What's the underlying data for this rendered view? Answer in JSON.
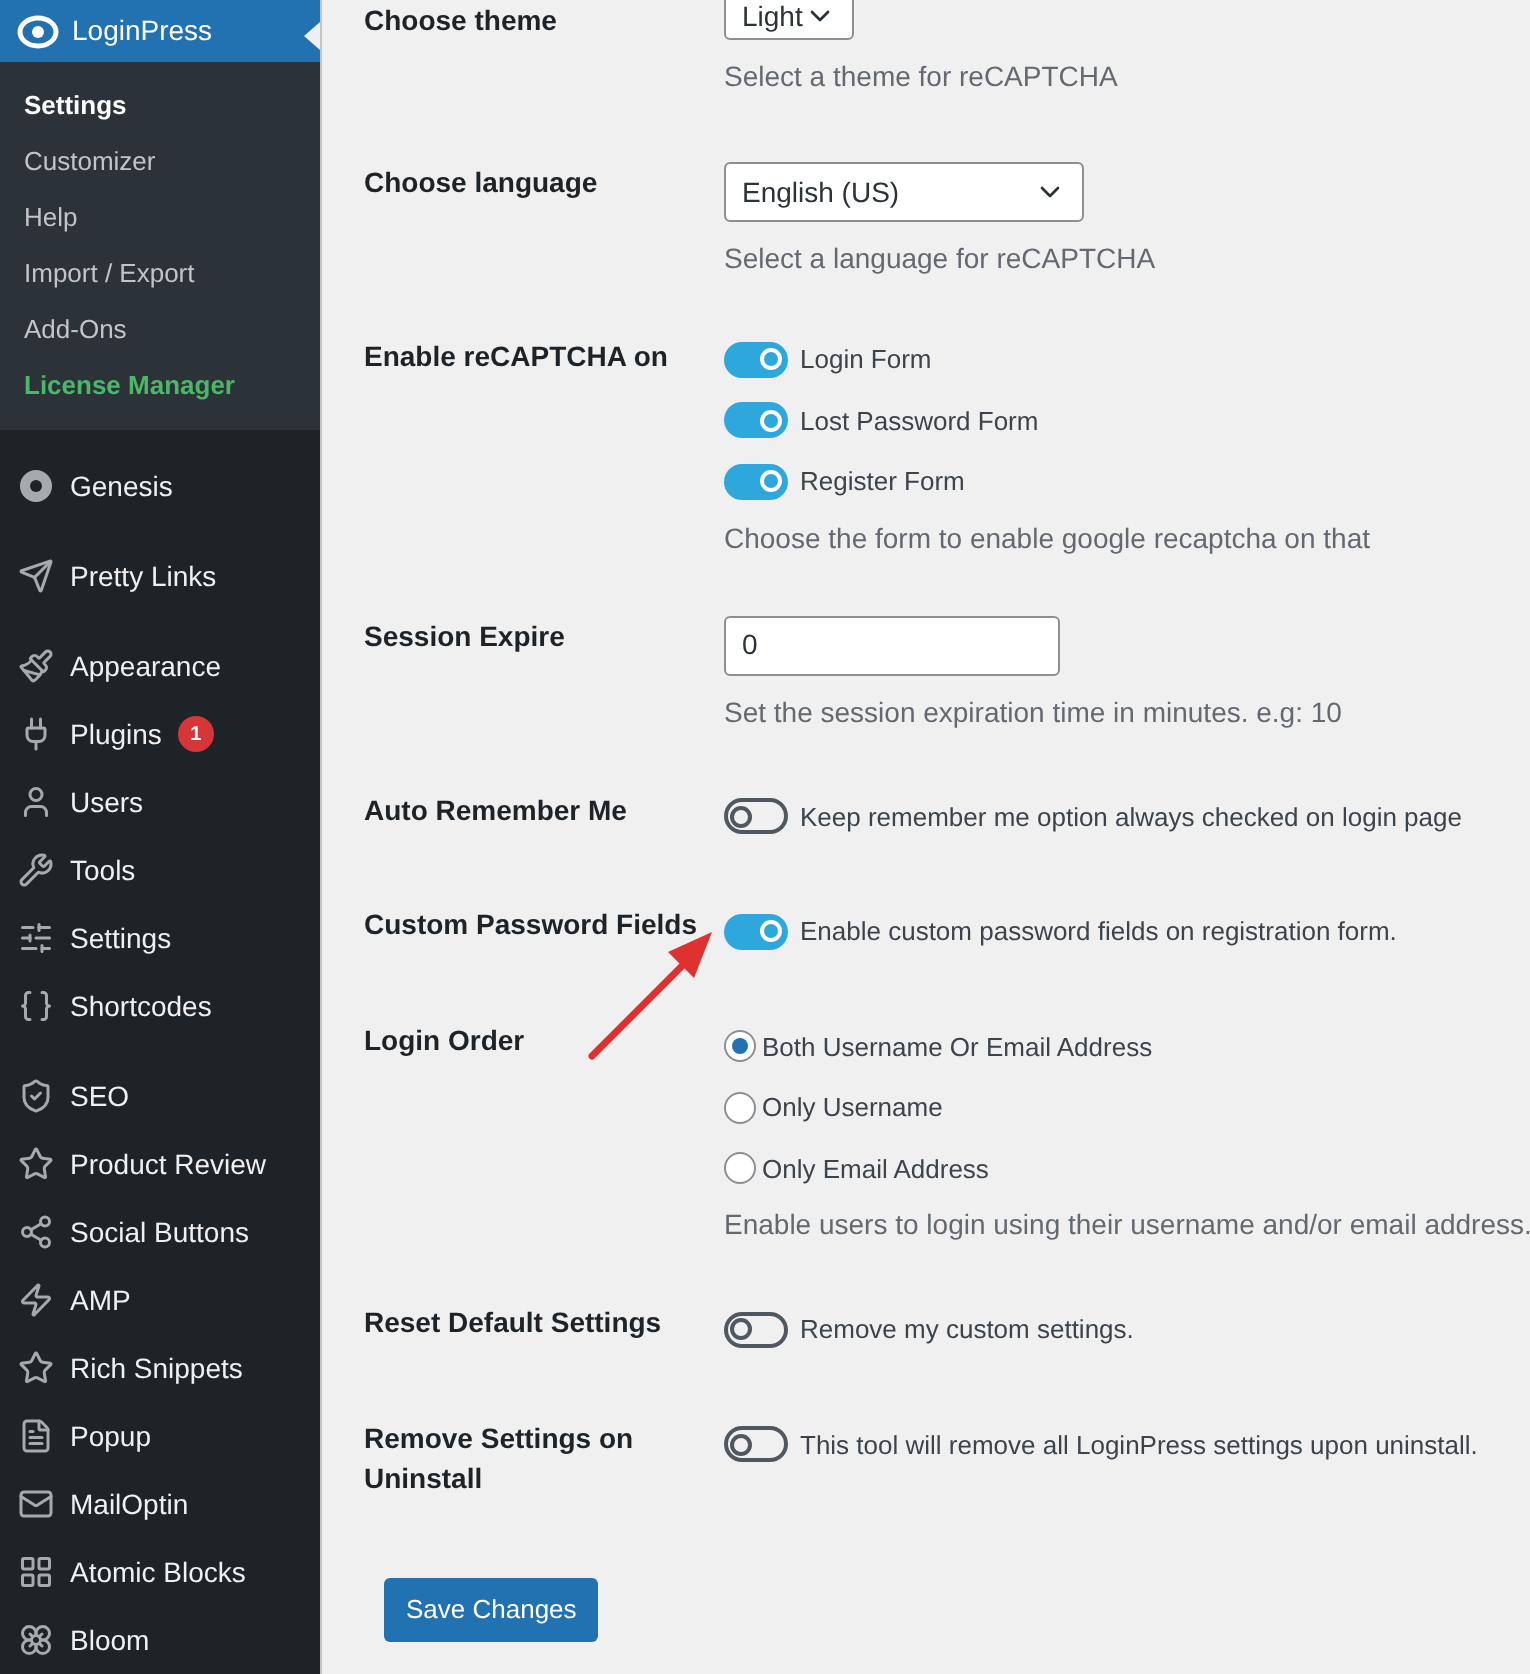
{
  "sidebar": {
    "header": {
      "label": "LoginPress",
      "selected": true
    },
    "submenu": [
      {
        "label": "Settings",
        "selected": true,
        "highlight": false
      },
      {
        "label": "Customizer",
        "selected": false,
        "highlight": false
      },
      {
        "label": "Help",
        "selected": false,
        "highlight": false
      },
      {
        "label": "Import / Export",
        "selected": false,
        "highlight": false
      },
      {
        "label": "Add-Ons",
        "selected": false,
        "highlight": false
      },
      {
        "label": "License Manager",
        "selected": false,
        "highlight": true
      }
    ],
    "groups": [
      [
        {
          "label": "Genesis"
        }
      ],
      [
        {
          "label": "Pretty Links"
        }
      ],
      [
        {
          "label": "Appearance"
        },
        {
          "label": "Plugins",
          "badge": "1"
        },
        {
          "label": "Users"
        },
        {
          "label": "Tools"
        },
        {
          "label": "Settings"
        },
        {
          "label": "Shortcodes"
        }
      ],
      [
        {
          "label": "SEO"
        },
        {
          "label": "Product Review"
        },
        {
          "label": "Social Buttons"
        },
        {
          "label": "AMP"
        },
        {
          "label": "Rich Snippets"
        },
        {
          "label": "Popup"
        },
        {
          "label": "MailOptin"
        },
        {
          "label": "Atomic Blocks"
        },
        {
          "label": "Bloom"
        }
      ]
    ]
  },
  "settings": [
    {
      "kind": "select",
      "label": "Choose theme",
      "value": "Light",
      "help": "Select a theme for reCAPTCHA"
    },
    {
      "kind": "select",
      "label": "Choose language",
      "value": "English (US)",
      "help": "Select a language for reCAPTCHA"
    },
    {
      "kind": "toggles",
      "label": "Enable reCAPTCHA on",
      "options": [
        {
          "label": "Login Form",
          "on": true
        },
        {
          "label": "Lost Password Form",
          "on": true
        },
        {
          "label": "Register Form",
          "on": true
        }
      ],
      "help": "Choose the form to enable google recaptcha on that"
    },
    {
      "kind": "input",
      "label": "Session Expire",
      "value": "0",
      "help": "Set the session expiration time in minutes. e.g: 10"
    },
    {
      "kind": "toggle",
      "label": "Auto Remember Me",
      "on": false,
      "text": "Keep remember me option always checked on login page"
    },
    {
      "kind": "toggle",
      "label": "Custom Password Fields",
      "on": true,
      "text": "Enable custom password fields on registration form."
    },
    {
      "kind": "radios",
      "label": "Login Order",
      "options": [
        {
          "label": "Both Username Or Email Address",
          "selected": true
        },
        {
          "label": "Only Username",
          "selected": false
        },
        {
          "label": "Only Email Address",
          "selected": false
        }
      ],
      "help": "Enable users to login using their username and/or email address."
    },
    {
      "kind": "toggle",
      "label": "Reset Default Settings",
      "on": false,
      "text": "Remove my custom settings."
    },
    {
      "kind": "toggle",
      "label": "Remove Settings on Uninstall",
      "on": false,
      "text": "This tool will remove all LoginPress settings upon uninstall."
    }
  ],
  "save_button": "Save Changes"
}
